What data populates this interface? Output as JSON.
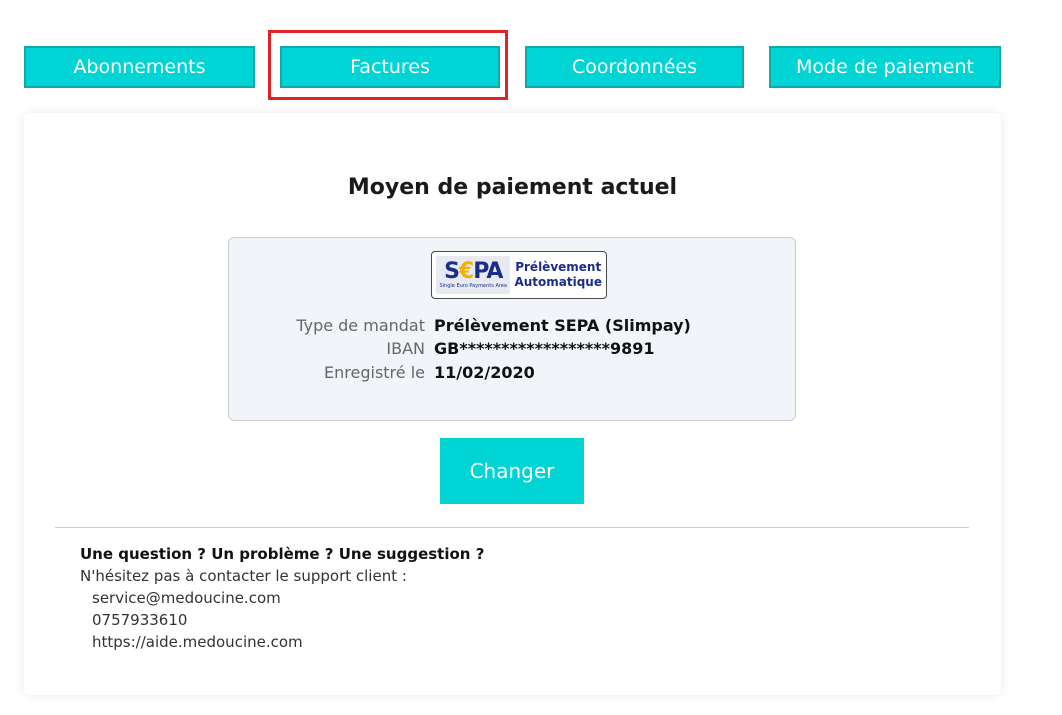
{
  "tabs": [
    {
      "label": "Abonnements",
      "active": false
    },
    {
      "label": "Factures",
      "active": false,
      "highlighted": true
    },
    {
      "label": "Coordonnées",
      "active": false
    },
    {
      "label": "Mode de paiement",
      "active": true
    }
  ],
  "colors": {
    "accent": "#00d4d4",
    "tab_border": "#10a8a8",
    "highlight": "#e02424",
    "sepa_blue": "#1b2d8a",
    "sepa_yellow": "#f2b100"
  },
  "card": {
    "title": "Moyen de paiement actuel"
  },
  "sepa_logo": {
    "word_left": "S",
    "word_euro": "€",
    "word_right": "PA",
    "subtitle": "Single Euro Payments Area",
    "line1": "Prélèvement",
    "line2": "Automatique"
  },
  "payment_info": [
    {
      "label": "Type de mandat",
      "value": "Prélèvement SEPA (Slimpay)"
    },
    {
      "label": "IBAN",
      "value": "GB******************9891"
    },
    {
      "label": "Enregistré le",
      "value": "11/02/2020"
    }
  ],
  "change_button": "Changer",
  "support": {
    "title": "Une question ? Un problème ? Une suggestion ?",
    "intro": "N'hésitez pas à contacter le support client :",
    "email": "service@medoucine.com",
    "phone": "0757933610",
    "url": "https://aide.medoucine.com"
  }
}
